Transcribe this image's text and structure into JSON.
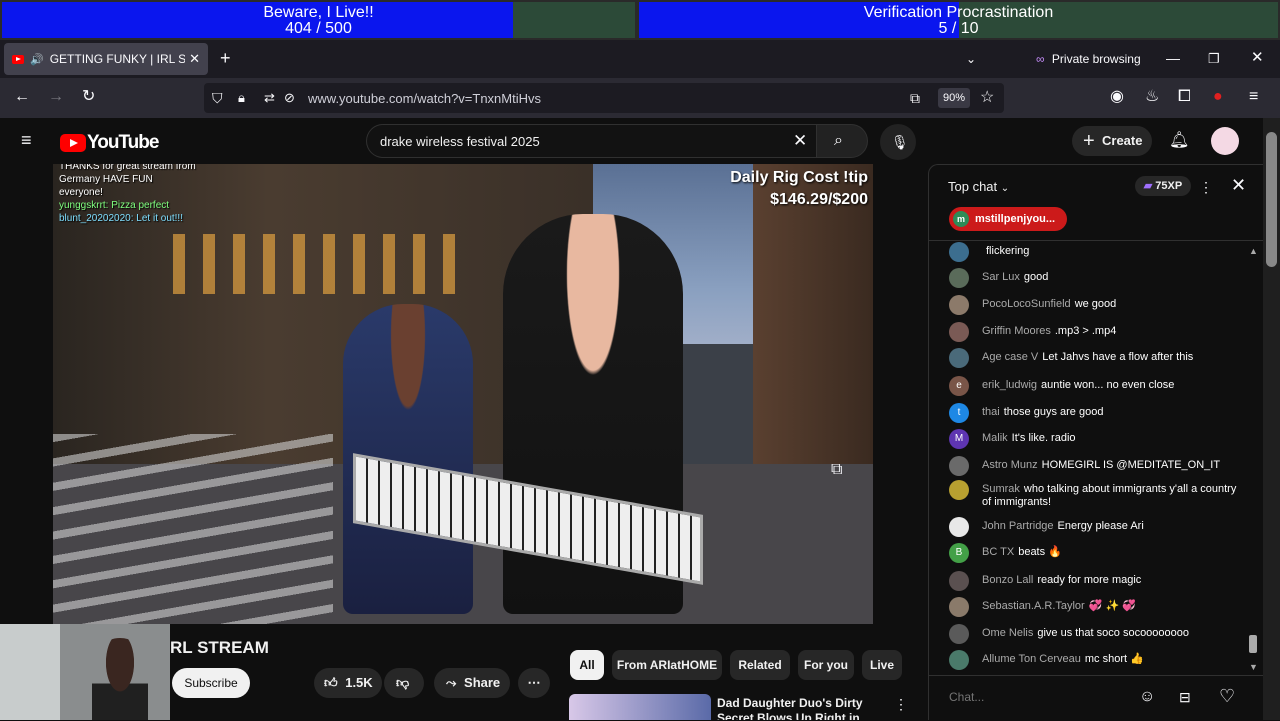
{
  "goals": [
    {
      "title": "Beware, I Live!!",
      "progress_text": "404 / 500",
      "fraction": 0.808
    },
    {
      "title": "Verification Procrastination",
      "progress_text": "5 / 10",
      "fraction": 0.5
    }
  ],
  "browser": {
    "tab_title": "GETTING FUNKY | IRL STRE",
    "private_label": "Private browsing",
    "url": "www.youtube.com/watch?v=TnxnMtiHvs",
    "zoom": "90%"
  },
  "youtube": {
    "logo_text": "YouTube",
    "search_query": "drake wireless festival 2025",
    "create_label": "Create"
  },
  "video": {
    "rig_line1": "Daily Rig Cost !tip",
    "rig_line2": "$146.29/$200",
    "overlay_lines": [
      "THANKS for great stream from",
      "Germany       HAVE FUN",
      "everyone!",
      "yunggskrrt:  Pizza perfect",
      "blunt_20202020:  Let it out!!!"
    ]
  },
  "below": {
    "channel_title_partial": "RL STREAM",
    "subscribe_label": "Subscribe",
    "likes": "1.5K",
    "share_label": "Share",
    "chips": [
      "All",
      "From ARIatHOME",
      "Related",
      "For you",
      "Live"
    ],
    "related_title": "Dad Daughter Duo's Dirty Secret Blows Up Right in Front of Cops"
  },
  "chat": {
    "mode_label": "Top chat",
    "xp_badge": "75XP",
    "pinned_user": "mstillpenjyou...",
    "input_placeholder": "Chat...",
    "messages": [
      {
        "author": "",
        "text": "flickering",
        "color": "#3c6e8f",
        "initial": ""
      },
      {
        "author": "Sar Lux",
        "text": "good",
        "color": "#5a6b5a",
        "initial": ""
      },
      {
        "author": "PocoLocoSunfield",
        "text": "we good",
        "color": "#8c7a6a",
        "initial": ""
      },
      {
        "author": "Griffin Moores",
        "text": ".mp3 > .mp4",
        "color": "#7a5a55",
        "initial": ""
      },
      {
        "author": "Age case V",
        "text": "Let Jahvs have a flow after this",
        "color": "#4a6a7a",
        "initial": ""
      },
      {
        "author": "erik_ludwig",
        "text": "auntie won... no even close",
        "color": "#795548",
        "initial": "e"
      },
      {
        "author": "thai",
        "text": "those guys are good",
        "color": "#1e88e5",
        "initial": "t"
      },
      {
        "author": "Malik",
        "text": "It's like. radio",
        "color": "#5e35b1",
        "initial": "M"
      },
      {
        "author": "Astro Munz",
        "text": "HOMEGIRL IS @MEDITATE_ON_IT",
        "color": "#6a6a6a",
        "initial": ""
      },
      {
        "author": "Sumrak",
        "text": "who talking about immigrants y'all a country of immigrants!",
        "color": "#b8a030",
        "initial": ""
      },
      {
        "author": "John Partridge",
        "text": "Energy please Ari",
        "color": "#e8e8e8",
        "initial": ""
      },
      {
        "author": "BC TX",
        "text": "beats 🔥",
        "color": "#43a047",
        "initial": "B"
      },
      {
        "author": "Bonzo Lall",
        "text": "ready for more magic",
        "color": "#5a5050",
        "initial": ""
      },
      {
        "author": "Sebastian.A.R.Taylor",
        "text": "💞 ✨ 💞",
        "color": "#8a7a6a",
        "initial": ""
      },
      {
        "author": "Ome Nelis",
        "text": "give us that soco socoooooooo",
        "color": "#5a5a5a",
        "initial": ""
      },
      {
        "author": "Allume Ton Cerveau",
        "text": "mc short 👍",
        "color": "#4a7a6a",
        "initial": ""
      }
    ]
  }
}
